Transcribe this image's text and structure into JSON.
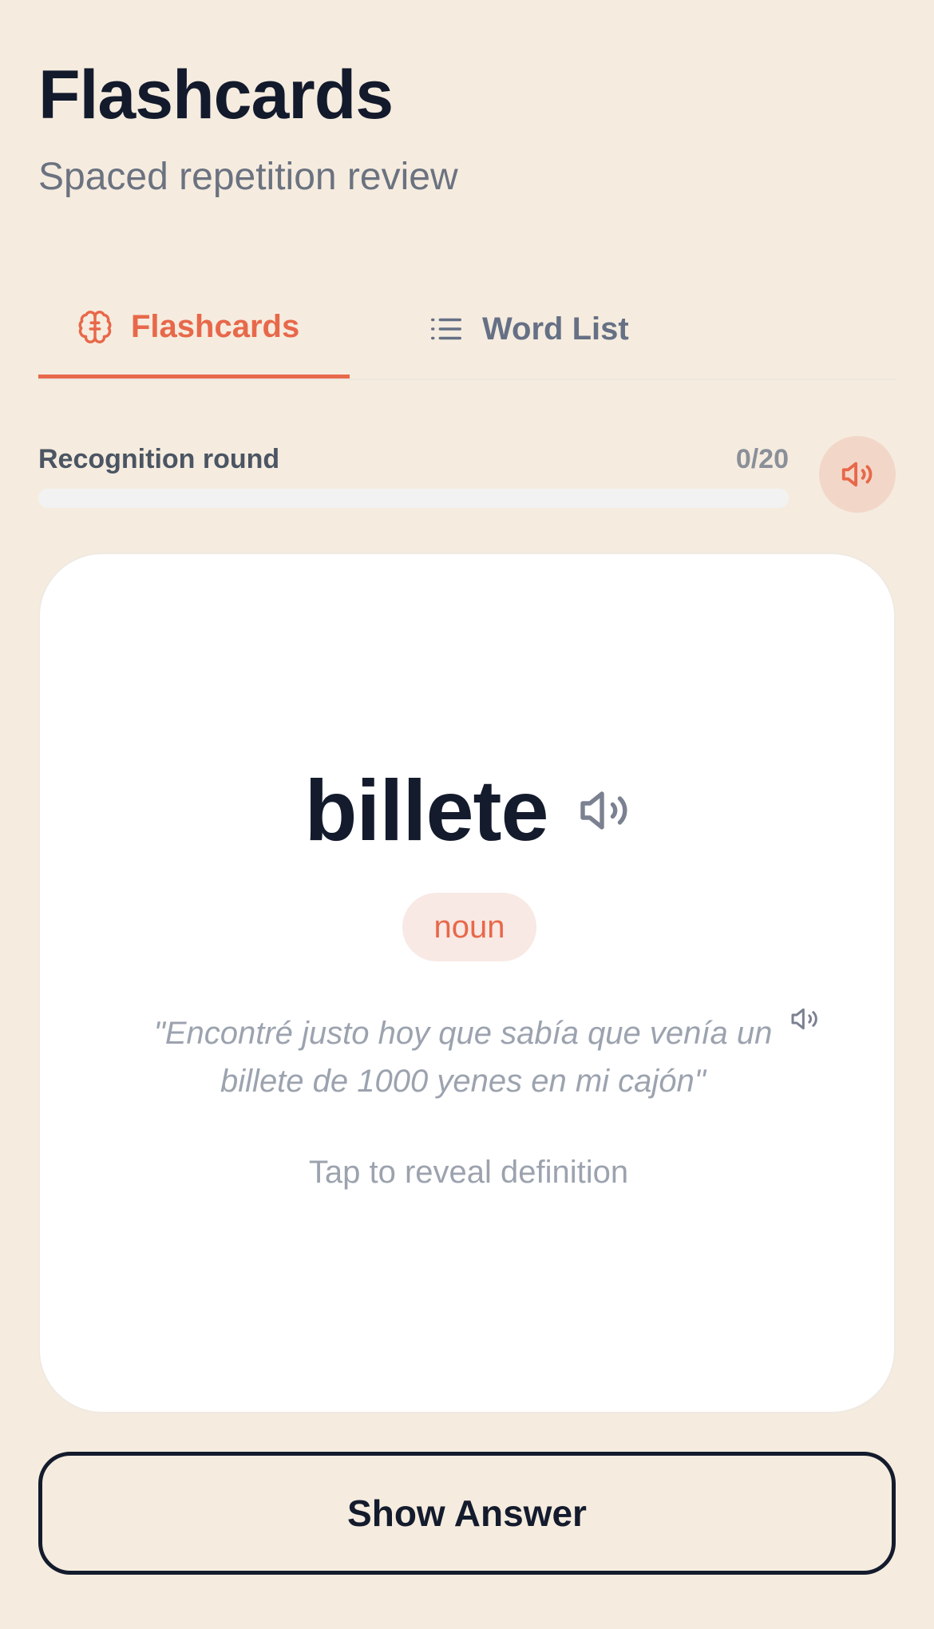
{
  "header": {
    "title": "Flashcards",
    "subtitle": "Spaced repetition review"
  },
  "tabs": [
    {
      "label": "Flashcards",
      "icon": "brain-icon",
      "active": true
    },
    {
      "label": "Word List",
      "icon": "list-icon",
      "active": false
    }
  ],
  "round": {
    "label": "Recognition round",
    "count_text": "0/20",
    "progress_fraction": 0,
    "sound_icon": "speaker-icon"
  },
  "card": {
    "word": "billete",
    "part_of_speech": "noun",
    "example": "\"Encontré justo hoy que sabía que venía un billete de 1000 yenes en mi cajón\"",
    "hint": "Tap to reveal definition",
    "word_sound_icon": "speaker-icon",
    "example_sound_icon": "speaker-icon"
  },
  "actions": {
    "show_answer_label": "Show Answer"
  },
  "colors": {
    "accent": "#e8684a",
    "background": "#f5ecdf",
    "text_dark": "#141b2d",
    "muted": "#9ca3af"
  }
}
